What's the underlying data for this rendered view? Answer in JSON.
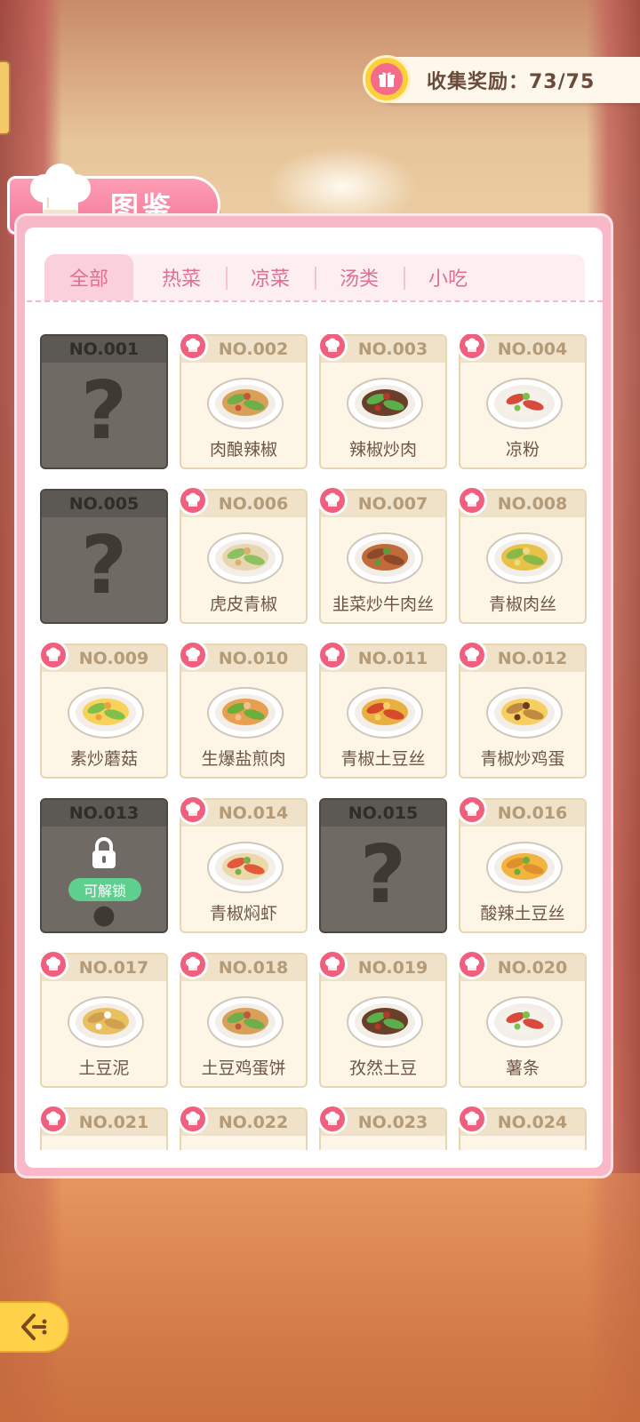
{
  "reward": {
    "label": "收集奖励：73/75"
  },
  "header": {
    "title": "图鉴"
  },
  "tabs": [
    {
      "label": "全部",
      "active": true
    },
    {
      "label": "热菜",
      "active": false
    },
    {
      "label": "凉菜",
      "active": false
    },
    {
      "label": "汤类",
      "active": false
    },
    {
      "label": "小吃",
      "active": false
    }
  ],
  "dishes": [
    {
      "no": "NO.001",
      "name": "",
      "status": "locked"
    },
    {
      "no": "NO.002",
      "name": "肉酿辣椒",
      "status": "unlocked"
    },
    {
      "no": "NO.003",
      "name": "辣椒炒肉",
      "status": "unlocked"
    },
    {
      "no": "NO.004",
      "name": "凉粉",
      "status": "unlocked"
    },
    {
      "no": "NO.005",
      "name": "",
      "status": "locked"
    },
    {
      "no": "NO.006",
      "name": "虎皮青椒",
      "status": "unlocked"
    },
    {
      "no": "NO.007",
      "name": "韭菜炒牛肉丝",
      "status": "unlocked"
    },
    {
      "no": "NO.008",
      "name": "青椒肉丝",
      "status": "unlocked"
    },
    {
      "no": "NO.009",
      "name": "素炒蘑菇",
      "status": "unlocked"
    },
    {
      "no": "NO.010",
      "name": "生爆盐煎肉",
      "status": "unlocked"
    },
    {
      "no": "NO.011",
      "name": "青椒土豆丝",
      "status": "unlocked"
    },
    {
      "no": "NO.012",
      "name": "青椒炒鸡蛋",
      "status": "unlocked"
    },
    {
      "no": "NO.013",
      "name": "",
      "status": "unlockable",
      "badge": "可解锁"
    },
    {
      "no": "NO.014",
      "name": "青椒焖虾",
      "status": "unlocked"
    },
    {
      "no": "NO.015",
      "name": "",
      "status": "locked"
    },
    {
      "no": "NO.016",
      "name": "酸辣土豆丝",
      "status": "unlocked"
    },
    {
      "no": "NO.017",
      "name": "土豆泥",
      "status": "unlocked"
    },
    {
      "no": "NO.018",
      "name": "土豆鸡蛋饼",
      "status": "unlocked"
    },
    {
      "no": "NO.019",
      "name": "孜然土豆",
      "status": "unlocked"
    },
    {
      "no": "NO.020",
      "name": "薯条",
      "status": "unlocked"
    },
    {
      "no": "NO.021",
      "name": "",
      "status": "unlocked"
    },
    {
      "no": "NO.022",
      "name": "",
      "status": "unlocked"
    },
    {
      "no": "NO.023",
      "name": "",
      "status": "unlocked"
    },
    {
      "no": "NO.024",
      "name": "",
      "status": "unlocked"
    }
  ],
  "colors": {
    "accent": "#f0607e",
    "panel": "#f8b8c8",
    "locked_card": "#6f6a63",
    "unlock_badge": "#5ecf8e"
  },
  "icons": {
    "reward": "gift-icon",
    "title": "chef-hat-icon",
    "back": "back-arrow-icon"
  }
}
